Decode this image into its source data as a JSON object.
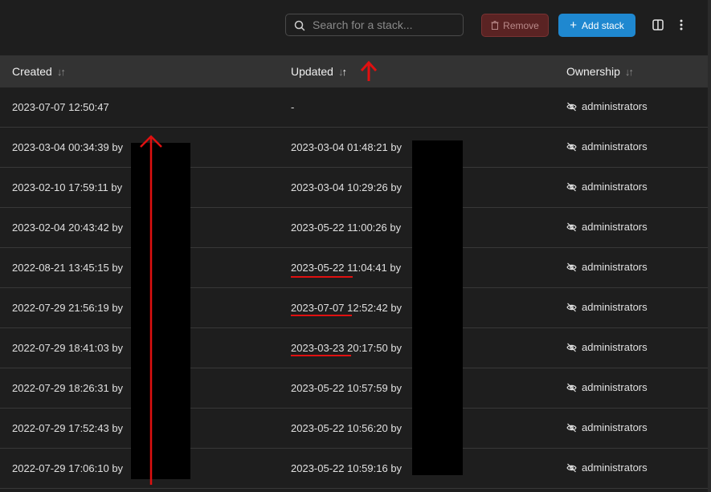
{
  "toolbar": {
    "search_placeholder": "Search for a stack...",
    "remove_label": "Remove",
    "add_label": "Add stack",
    "search_icon": "search-icon",
    "columns_icon": "columns-icon",
    "more_icon": "kebab-menu-icon"
  },
  "table": {
    "columns": [
      {
        "label": "Created",
        "sort_icon": "sort-icon"
      },
      {
        "label": "Updated",
        "sort_icon": "sort-desc-icon"
      },
      {
        "label": "Ownership",
        "sort_icon": "sort-icon"
      }
    ],
    "rows": [
      {
        "created": "2023-07-07 12:50:47",
        "updated": "-",
        "ownership": "administrators"
      },
      {
        "created": "2023-03-04 00:34:39 by",
        "updated": "2023-03-04 01:48:21 by",
        "ownership": "administrators"
      },
      {
        "created": "2023-02-10 17:59:11 by",
        "updated": "2023-03-04 10:29:26 by",
        "ownership": "administrators"
      },
      {
        "created": "2023-02-04 20:43:42 by",
        "updated": "2023-05-22 11:00:26 by",
        "ownership": "administrators"
      },
      {
        "created": "2022-08-21 13:45:15 by",
        "updated": "2023-05-22 11:04:41 by",
        "ownership": "administrators"
      },
      {
        "created": "2022-07-29 21:56:19 by",
        "updated": "2023-07-07 12:52:42 by",
        "ownership": "administrators"
      },
      {
        "created": "2022-07-29 18:41:03 by",
        "updated": "2023-03-23 20:17:50 by",
        "ownership": "administrators"
      },
      {
        "created": "2022-07-29 18:26:31 by",
        "updated": "2023-05-22 10:57:59 by",
        "ownership": "administrators"
      },
      {
        "created": "2022-07-29 17:52:43 by",
        "updated": "2023-05-22 10:56:20 by",
        "ownership": "administrators"
      },
      {
        "created": "2022-07-29 17:06:10 by",
        "updated": "2023-05-22 10:59:16 by",
        "ownership": "administrators"
      }
    ]
  },
  "colors": {
    "background": "#1e1e1e",
    "header": "#333333",
    "accent_blue": "#1f88d0",
    "danger": "#5a2323",
    "annotation_red": "#e01010"
  }
}
